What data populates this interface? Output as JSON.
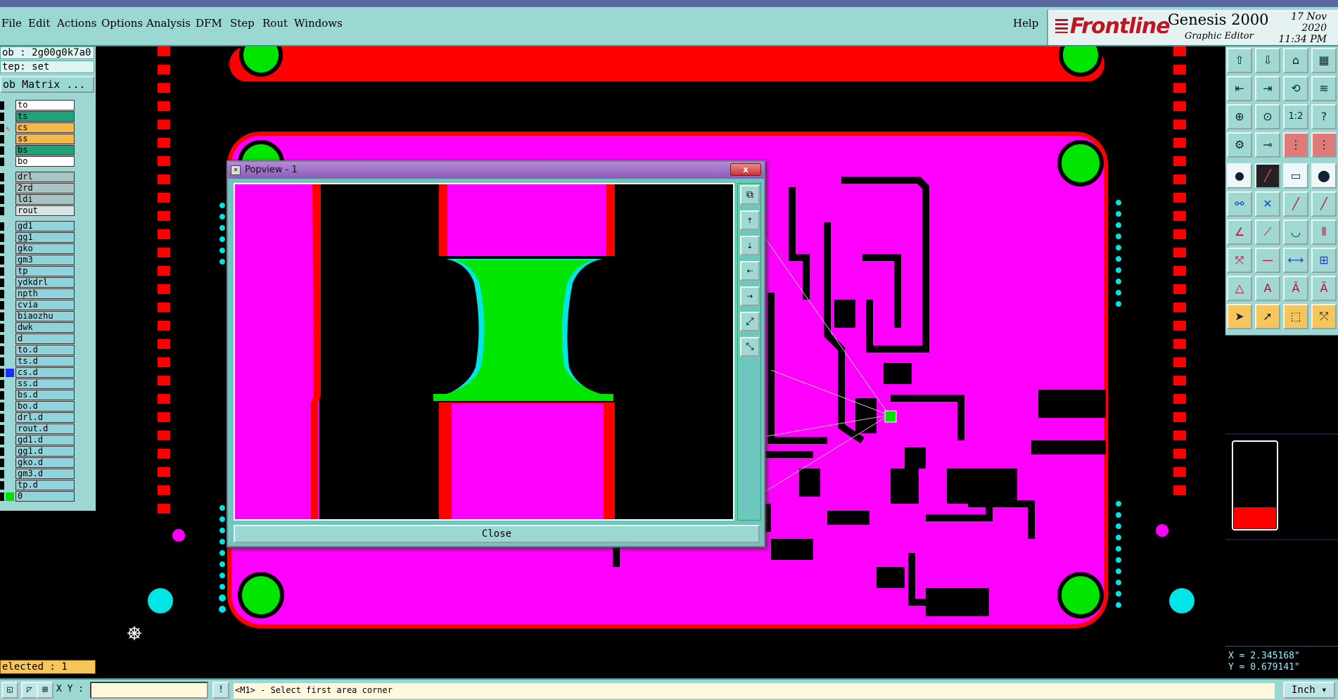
{
  "menu": {
    "items": [
      "File",
      "Edit",
      "Actions",
      "Options",
      "Analysis",
      "DFM",
      "Step",
      "Rout",
      "Windows"
    ],
    "help": "Help"
  },
  "brand": {
    "logo": "Frontline",
    "product": "Genesis 2000",
    "subtitle": "Graphic Editor",
    "date": "17 Nov 2020",
    "time": "11:34 PM"
  },
  "left_panel": {
    "job": "ob : 2g00g0k7a0",
    "step": "tep: set",
    "job_matrix": "ob Matrix ...",
    "layers": [
      {
        "name": "to",
        "bg": "#ffffff"
      },
      {
        "name": "ts",
        "bg": "#1fa37a"
      },
      {
        "name": "cs",
        "bg": "#f7b84a",
        "work": true
      },
      {
        "name": "ss",
        "bg": "#f7b84a"
      },
      {
        "name": "bs",
        "bg": "#1fa37a"
      },
      {
        "name": "bo",
        "bg": "#ffffff"
      },
      {
        "name": "drl",
        "bg": "#a9c4c4"
      },
      {
        "name": "2rd",
        "bg": "#a9c4c4"
      },
      {
        "name": "ldi",
        "bg": "#a9c4c4"
      },
      {
        "name": "rout",
        "bg": "#d7e4e4"
      },
      {
        "name": "gd1",
        "bg": "#8fd4dd"
      },
      {
        "name": "gg1",
        "bg": "#8fd4dd"
      },
      {
        "name": "gko",
        "bg": "#8fd4dd"
      },
      {
        "name": "gm3",
        "bg": "#8fd4dd"
      },
      {
        "name": "tp",
        "bg": "#8fd4dd"
      },
      {
        "name": "ydkdrl",
        "bg": "#8fd4dd"
      },
      {
        "name": "npth",
        "bg": "#8fd4dd"
      },
      {
        "name": "cvia",
        "bg": "#8fd4dd"
      },
      {
        "name": "biaozhu",
        "bg": "#8fd4dd"
      },
      {
        "name": "dwk",
        "bg": "#8fd4dd"
      },
      {
        "name": "d",
        "bg": "#8fd4dd"
      },
      {
        "name": "to.d",
        "bg": "#8fd4dd"
      },
      {
        "name": "ts.d",
        "bg": "#8fd4dd"
      },
      {
        "name": "cs.d",
        "bg": "#8fd4dd",
        "color": "#1a2cff"
      },
      {
        "name": "ss.d",
        "bg": "#8fd4dd"
      },
      {
        "name": "bs.d",
        "bg": "#8fd4dd"
      },
      {
        "name": "bo.d",
        "bg": "#8fd4dd"
      },
      {
        "name": "drl.d",
        "bg": "#8fd4dd"
      },
      {
        "name": "rout.d",
        "bg": "#8fd4dd"
      },
      {
        "name": "gd1.d",
        "bg": "#8fd4dd"
      },
      {
        "name": "gg1.d",
        "bg": "#8fd4dd"
      },
      {
        "name": "gko.d",
        "bg": "#8fd4dd"
      },
      {
        "name": "gm3.d",
        "bg": "#8fd4dd"
      },
      {
        "name": "tp.d",
        "bg": "#8fd4dd"
      },
      {
        "name": "0",
        "bg": "#8fd4dd",
        "color": "#00e000"
      }
    ],
    "selected": "elected : 1"
  },
  "popview": {
    "title": "Popview - 1",
    "close_x": "x",
    "close_button": "Close"
  },
  "coords": {
    "x": "X = 2.345168\"",
    "y": "Y = 0.679141\""
  },
  "status": {
    "xy_label": "X Y :",
    "xy_value": "",
    "prompt": "<M1> - Select first area corner",
    "units": "Inch"
  },
  "colors": {
    "board": "#ff00ff",
    "copper_red": "#ff0000",
    "pad_green": "#00e600",
    "cyan": "#00e5e5",
    "panel": "#9bd8d4"
  }
}
